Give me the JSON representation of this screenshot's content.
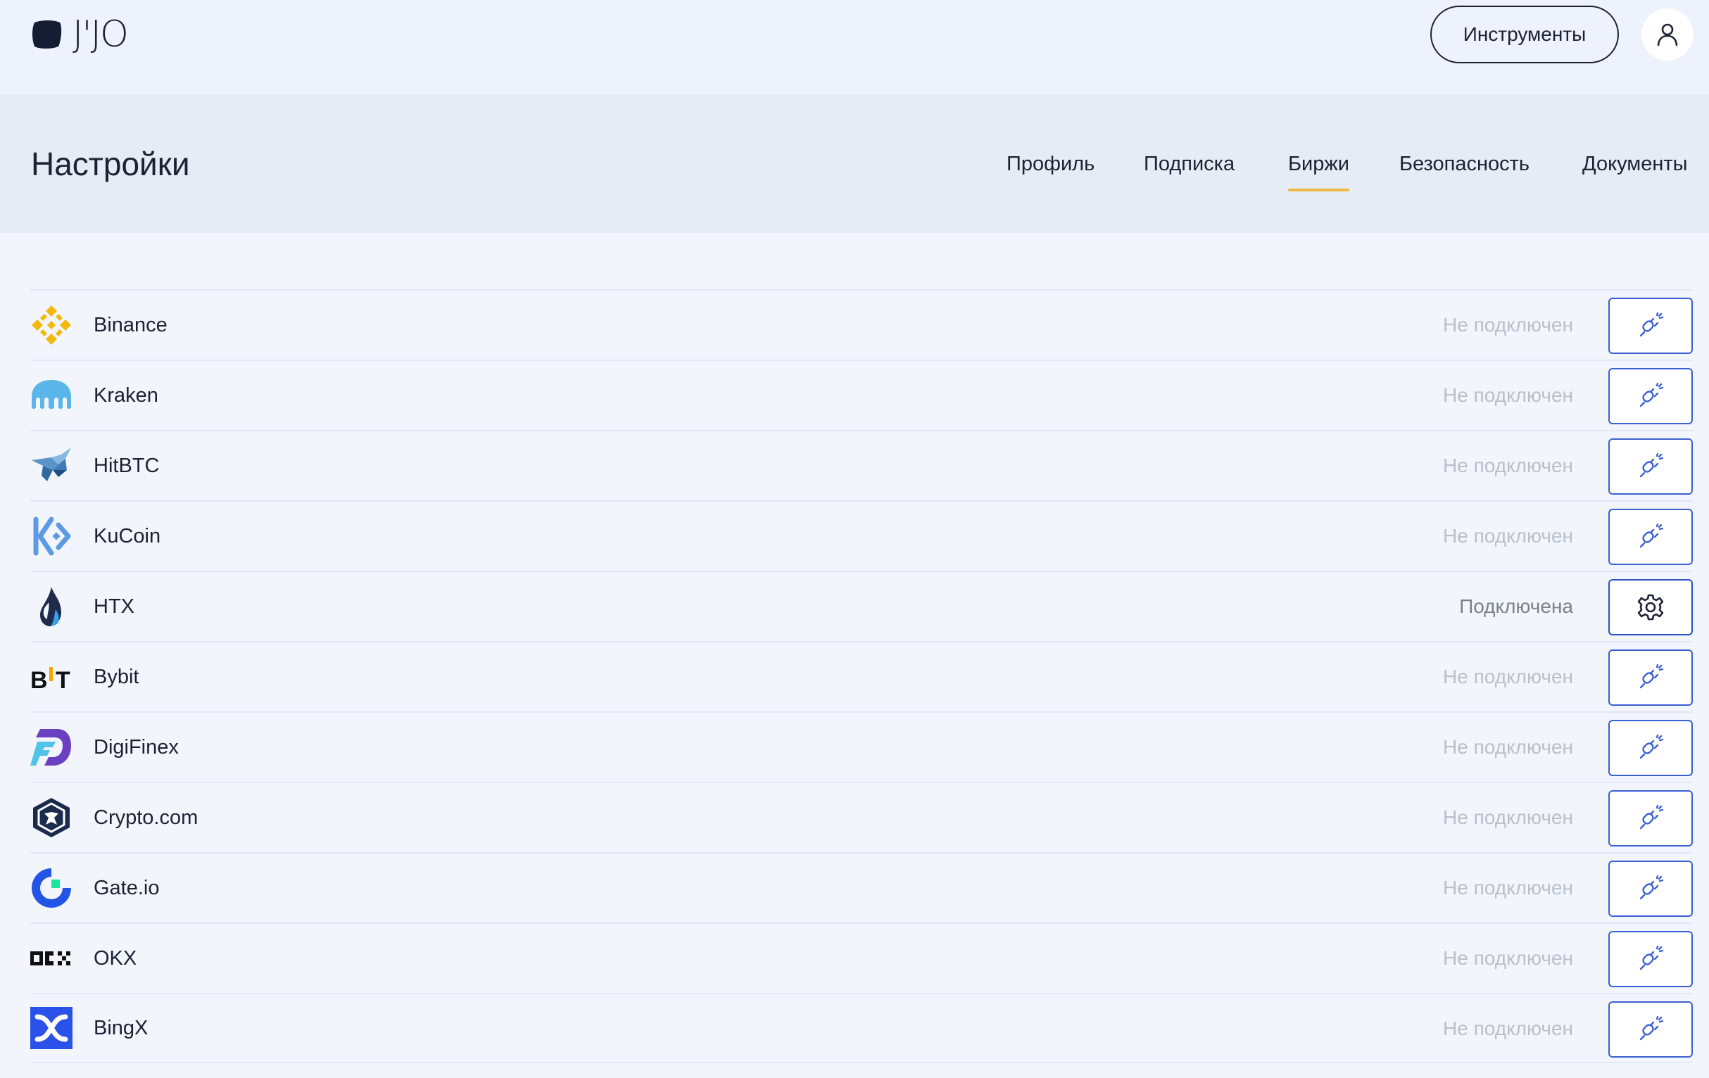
{
  "app": {
    "logo_text": "J'JO",
    "tools_button": "Инструменты"
  },
  "settings": {
    "title": "Настройки",
    "tabs": [
      {
        "label": "Профиль",
        "active": false
      },
      {
        "label": "Подписка",
        "active": false
      },
      {
        "label": "Биржи",
        "active": true
      },
      {
        "label": "Безопасность",
        "active": false
      },
      {
        "label": "Документы",
        "active": false
      }
    ]
  },
  "exchanges": [
    {
      "name": "Binance",
      "status": "Не подключен",
      "connected": false,
      "icon": "binance-icon",
      "action_icon": "plug-icon"
    },
    {
      "name": "Kraken",
      "status": "Не подключен",
      "connected": false,
      "icon": "kraken-icon",
      "action_icon": "plug-icon"
    },
    {
      "name": "HitBTC",
      "status": "Не подключен",
      "connected": false,
      "icon": "hitbtc-icon",
      "action_icon": "plug-icon"
    },
    {
      "name": "KuCoin",
      "status": "Не подключен",
      "connected": false,
      "icon": "kucoin-icon",
      "action_icon": "plug-icon"
    },
    {
      "name": "HTX",
      "status": "Подключена",
      "connected": true,
      "icon": "htx-icon",
      "action_icon": "gear-icon"
    },
    {
      "name": "Bybit",
      "status": "Не подключен",
      "connected": false,
      "icon": "bybit-icon",
      "action_icon": "plug-icon"
    },
    {
      "name": "DigiFinex",
      "status": "Не подключен",
      "connected": false,
      "icon": "digifinex-icon",
      "action_icon": "plug-icon"
    },
    {
      "name": "Crypto.com",
      "status": "Не подключен",
      "connected": false,
      "icon": "cryptocom-icon",
      "action_icon": "plug-icon"
    },
    {
      "name": "Gate.io",
      "status": "Не подключен",
      "connected": false,
      "icon": "gateio-icon",
      "action_icon": "plug-icon"
    },
    {
      "name": "OKX",
      "status": "Не подключен",
      "connected": false,
      "icon": "okx-icon",
      "action_icon": "plug-icon"
    },
    {
      "name": "BingX",
      "status": "Не подключен",
      "connected": false,
      "icon": "bingx-icon",
      "action_icon": "plug-icon"
    }
  ],
  "colors": {
    "accent": "#3c5fd2",
    "tab_underline": "#f0b840",
    "text": "#1c2233",
    "status_muted": "#b9bfcb",
    "status_connected": "#7a818e"
  }
}
